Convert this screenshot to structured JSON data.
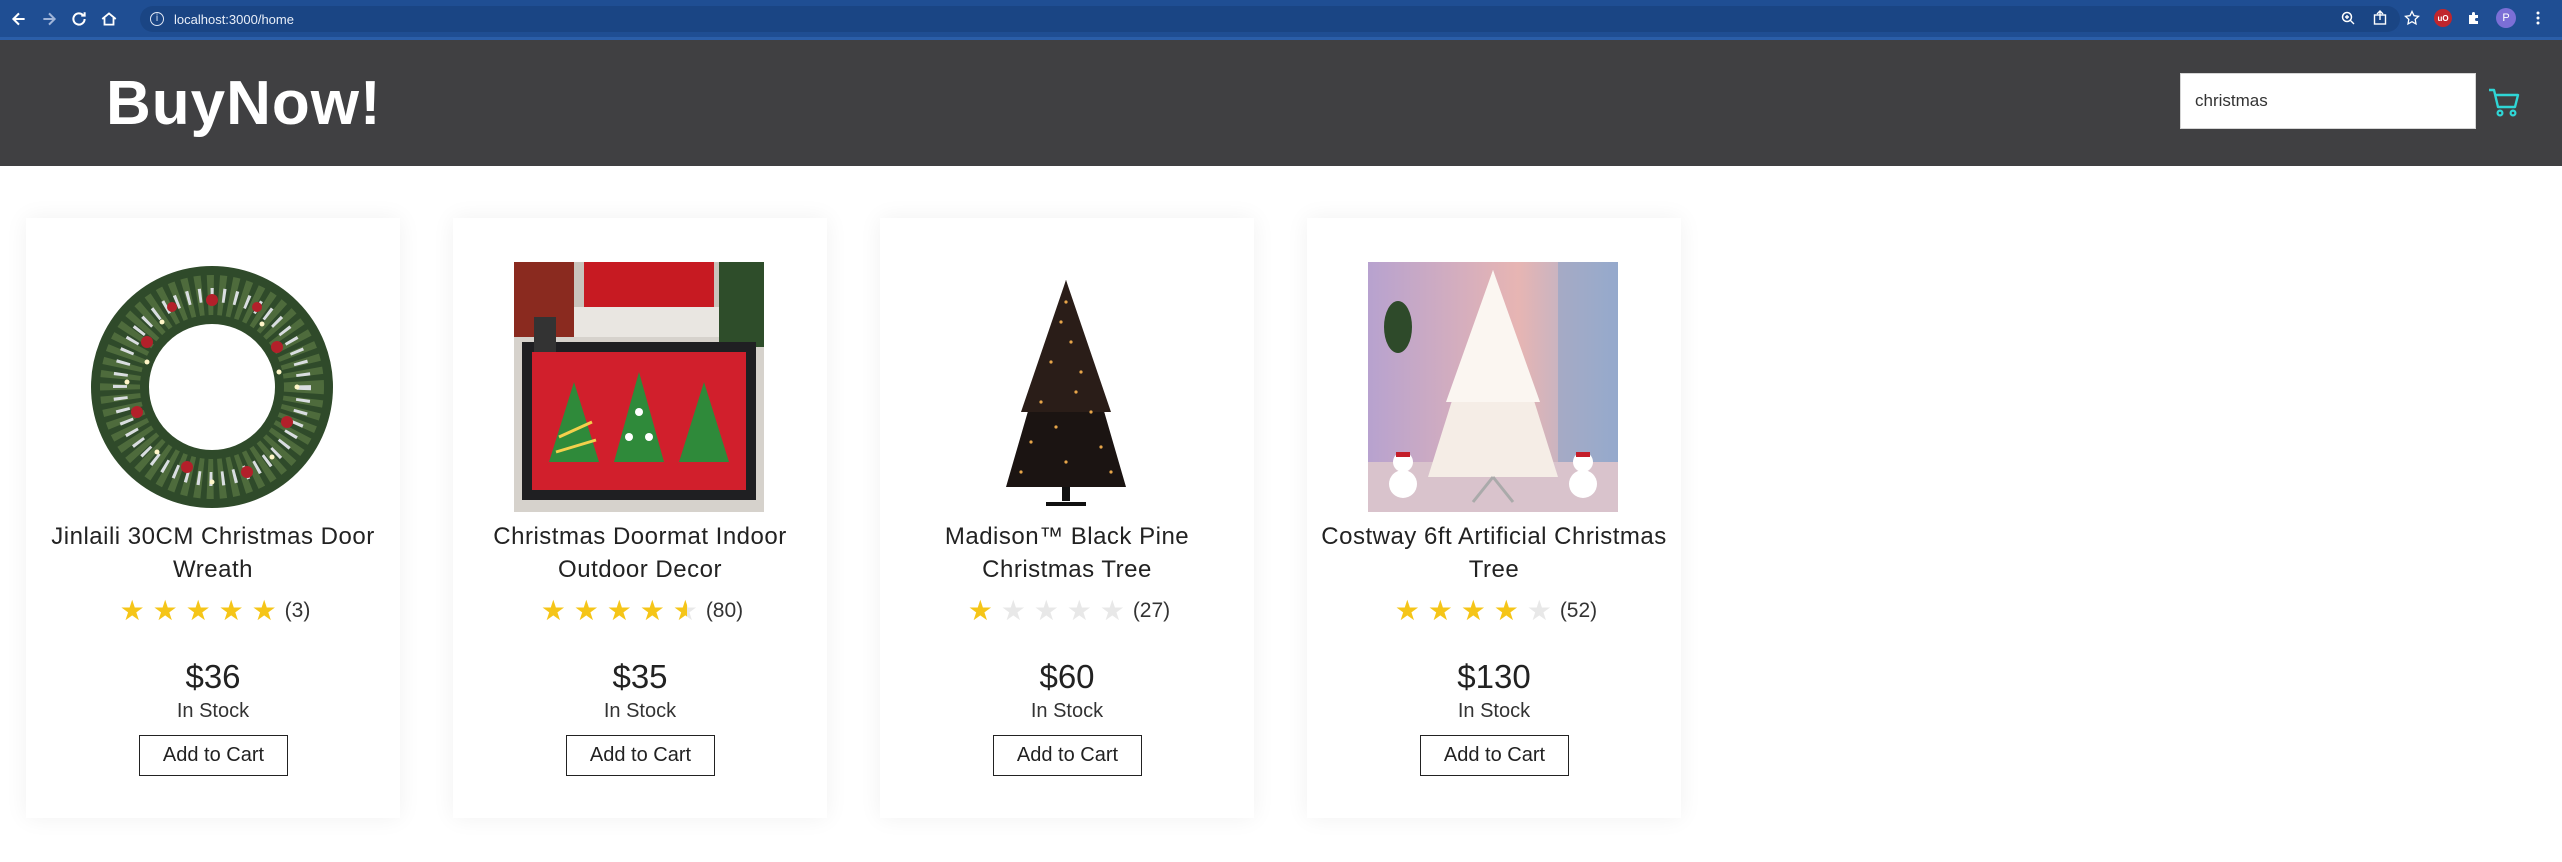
{
  "browser": {
    "url": "localhost:3000/home",
    "profile_initial": "P"
  },
  "header": {
    "brand": "BuyNow!",
    "search_value": "christmas"
  },
  "products": [
    {
      "title": "Jinlaili 30CM Christmas Door Wreath",
      "rating": 5,
      "review_count": "(3)",
      "price": "$36",
      "stock": "In Stock",
      "button": "Add to Cart"
    },
    {
      "title": "Christmas Doormat Indoor Outdoor Decor",
      "rating": 4.5,
      "review_count": "(80)",
      "price": "$35",
      "stock": "In Stock",
      "button": "Add to Cart"
    },
    {
      "title": "Madison™ Black Pine Christmas Tree",
      "rating": 1,
      "review_count": "(27)",
      "price": "$60",
      "stock": "In Stock",
      "button": "Add to Cart"
    },
    {
      "title": "Costway 6ft Artificial Christmas Tree",
      "rating": 4,
      "review_count": "(52)",
      "price": "$130",
      "stock": "In Stock",
      "button": "Add to Cart"
    }
  ],
  "colors": {
    "header_bg": "#404042",
    "star": "#f5c518",
    "cart_icon": "#2fd6d6"
  }
}
